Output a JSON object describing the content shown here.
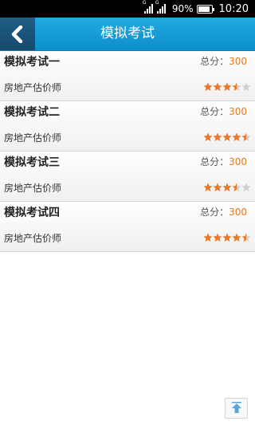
{
  "status_bar": {
    "signal1_label": "G",
    "signal2_label": "G",
    "battery": "90%",
    "time": "10:20"
  },
  "header": {
    "title": "模拟考试",
    "back_icon": "chevron-left-icon"
  },
  "score_label": "总分：",
  "exams": [
    {
      "title": "模拟考试一",
      "score": "300",
      "category": "房地产估价师",
      "rating": 3.5
    },
    {
      "title": "模拟考试二",
      "score": "300",
      "category": "房地产估价师",
      "rating": 4.5
    },
    {
      "title": "模拟考试三",
      "score": "300",
      "category": "房地产估价师",
      "rating": 3.5
    },
    {
      "title": "模拟考试四",
      "score": "300",
      "category": "房地产估价师",
      "rating": 4.5
    }
  ],
  "colors": {
    "header": "#1a9ad6",
    "star_filled": "#e8792a",
    "star_empty": "#d0d0d0",
    "score_value": "#e07b1f"
  },
  "scroll_top_icon": "arrow-up-icon"
}
